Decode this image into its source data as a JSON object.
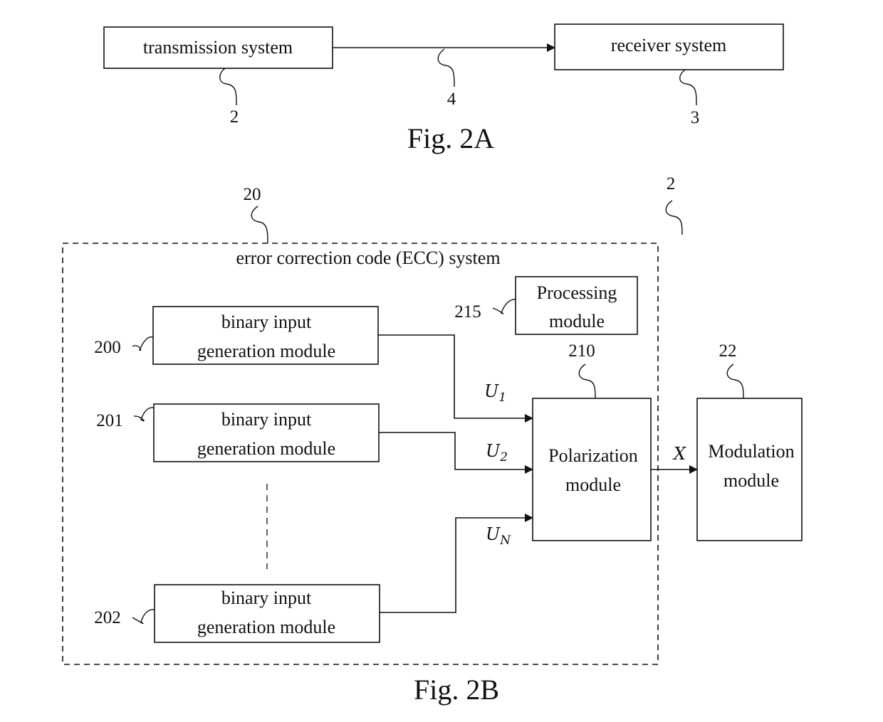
{
  "fig2a": {
    "caption": "Fig. 2A",
    "transmission_system": {
      "label": "transmission system",
      "ref": "2"
    },
    "receiver_system": {
      "label": "receiver system",
      "ref": "3"
    },
    "channel": {
      "ref": "4"
    }
  },
  "fig2b": {
    "caption": "Fig. 2B",
    "outer_ref": "2",
    "ecc_system": {
      "label": "error correction code (ECC) system",
      "ref": "20"
    },
    "binary_modules": [
      {
        "line1": "binary input",
        "line2": "generation module",
        "ref": "200"
      },
      {
        "line1": "binary input",
        "line2": "generation module",
        "ref": "201"
      },
      {
        "line1": "binary input",
        "line2": "generation module",
        "ref": "202"
      }
    ],
    "processing_module": {
      "line1": "Processing",
      "line2": "module",
      "ref": "215"
    },
    "polarization_module": {
      "line1": "Polarization",
      "line2": "module",
      "ref": "210"
    },
    "modulation_module": {
      "line1": "Modulation",
      "line2": "module",
      "ref": "22"
    },
    "signals": {
      "u1": {
        "base": "U",
        "sub": "1"
      },
      "u2": {
        "base": "U",
        "sub": "2"
      },
      "un": {
        "base": "U",
        "sub": "N"
      },
      "x": "X"
    }
  }
}
